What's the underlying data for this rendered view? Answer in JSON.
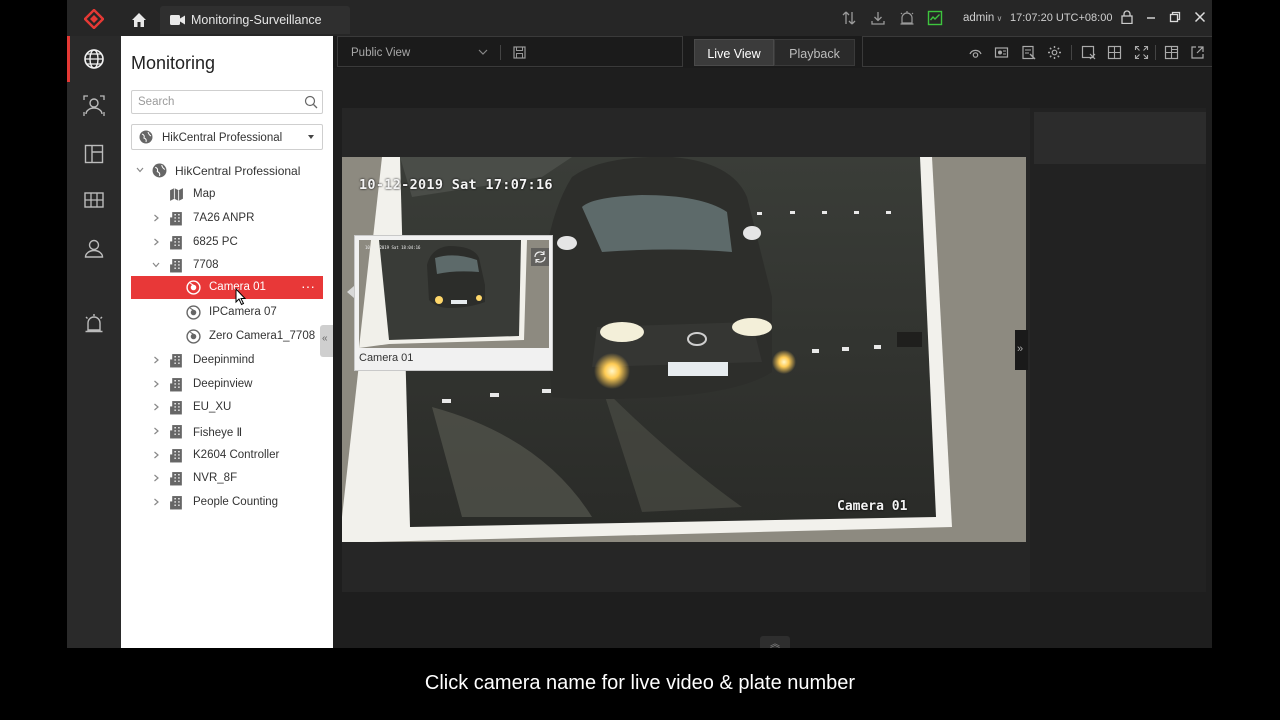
{
  "titlebar": {
    "tab_label": "Monitoring-Surveillance",
    "user": "admin",
    "time": "17:07:20 UTC+08:00",
    "icons": [
      "logo-icon",
      "home-icon",
      "transfer-icon",
      "download-icon",
      "alarm-icon",
      "health-monitor-icon",
      "lock-icon",
      "minimize-icon",
      "restore-icon",
      "close-icon"
    ]
  },
  "rail": {
    "icons": [
      "monitoring-globe-icon",
      "person-search-icon",
      "layout-icon",
      "grid-icon",
      "user-icon",
      "alarm-bell-icon"
    ]
  },
  "panel": {
    "title": "Monitoring",
    "search_placeholder": "Search",
    "site_select": "HikCentral Professional",
    "root": "HikCentral Professional",
    "items": [
      {
        "label": "Map",
        "type": "map"
      },
      {
        "label": "7A26 ANPR",
        "type": "area"
      },
      {
        "label": "6825 PC",
        "type": "area"
      },
      {
        "label": "7708",
        "type": "area",
        "expanded": true
      },
      {
        "label": "Camera 01",
        "type": "camera",
        "selected": true
      },
      {
        "label": "IPCamera 07",
        "type": "camera"
      },
      {
        "label": "Zero Camera1_7708",
        "type": "camera"
      },
      {
        "label": "Deepinmind",
        "type": "area"
      },
      {
        "label": "Deepinview",
        "type": "area"
      },
      {
        "label": "EU_XU",
        "type": "area"
      },
      {
        "label": "Fisheye Ⅱ",
        "type": "area"
      },
      {
        "label": "K2604 Controller",
        "type": "area"
      },
      {
        "label": "NVR_8F",
        "type": "area"
      },
      {
        "label": "People Counting",
        "type": "area"
      }
    ],
    "more": "···"
  },
  "toolbar": {
    "view_select": "Public View",
    "live_view": "Live View",
    "playback": "Playback",
    "tools": [
      "capture-icon",
      "record-icon",
      "tag-icon",
      "settings-icon",
      "window-close-icon",
      "split-layout-icon",
      "fullscreen-icon",
      "custom-layout-icon",
      "pop-out-icon"
    ]
  },
  "video": {
    "osd_time": "10-12-2019 Sat 17:07:16",
    "osd_camera": "Camera 01"
  },
  "popup": {
    "label": "Camera 01"
  },
  "caption": "Click camera name for live video & plate number",
  "colors": {
    "accent": "#e83838",
    "panel_bg": "#ffffff",
    "app_bg": "#1e1e1e"
  }
}
